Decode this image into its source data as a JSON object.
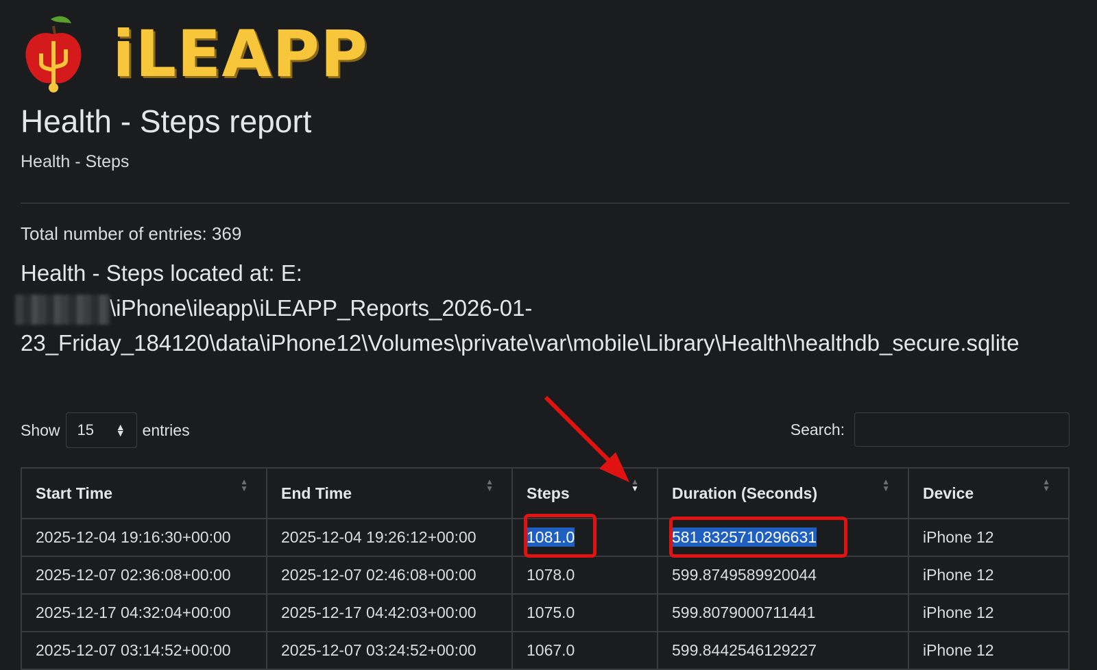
{
  "app": {
    "logo_text": "iLEAPP"
  },
  "header": {
    "title": "Health - Steps report",
    "subtitle": "Health - Steps"
  },
  "summary": {
    "total": "Total number of entries: 369",
    "location_line1": "Health - Steps located at: E:",
    "location_line2": "\\iPhone\\ileapp\\iLEAPP_Reports_2026-01-",
    "location_line3": "23_Friday_184120\\data\\iPhone12\\Volumes\\private\\var\\mobile\\Library\\Health\\healthdb_secure.sqlite"
  },
  "controls": {
    "show_label": "Show",
    "entries_value": "15",
    "entries_label": "entries",
    "search_label": "Search:",
    "search_value": ""
  },
  "table": {
    "columns": [
      "Start Time",
      "End Time",
      "Steps",
      "Duration (Seconds)",
      "Device"
    ],
    "rows": [
      [
        "2025-12-04 19:16:30+00:00",
        "2025-12-04 19:26:12+00:00",
        "1081.0",
        "581.8325710296631",
        "iPhone 12"
      ],
      [
        "2025-12-07 02:36:08+00:00",
        "2025-12-07 02:46:08+00:00",
        "1078.0",
        "599.8749589920044",
        "iPhone 12"
      ],
      [
        "2025-12-17 04:32:04+00:00",
        "2025-12-17 04:42:03+00:00",
        "1075.0",
        "599.8079000711441",
        "iPhone 12"
      ],
      [
        "2025-12-07 03:14:52+00:00",
        "2025-12-07 03:24:52+00:00",
        "1067.0",
        "599.8442546129227",
        "iPhone 12"
      ]
    ]
  },
  "colors": {
    "accent_logo": "#f7c63b",
    "highlight": "#1f5fbf",
    "annotation": "#e11212"
  }
}
